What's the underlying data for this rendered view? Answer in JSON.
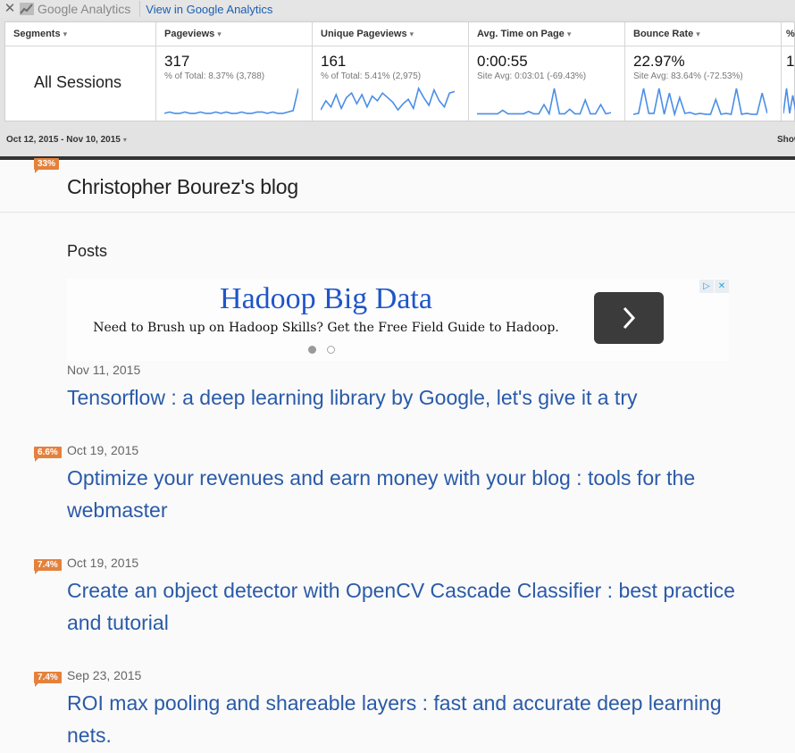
{
  "ga": {
    "close_glyph": "✕",
    "logo_text": "Google Analytics",
    "view_link": "View in Google Analytics",
    "segments_label": "Segments",
    "segment_value": "All Sessions",
    "metrics": [
      {
        "label": "Pageviews",
        "value": "317",
        "sub": "% of Total: 8.37% (3,788)",
        "spark": [
          2,
          3,
          2,
          2,
          3,
          2,
          2,
          3,
          2,
          2,
          3,
          2,
          3,
          2,
          2,
          3,
          2,
          2,
          3,
          3,
          2,
          3,
          2,
          2,
          3,
          4,
          20
        ]
      },
      {
        "label": "Unique Pageviews",
        "value": "161",
        "sub": "% of Total: 5.41% (2,975)",
        "spark": [
          4,
          10,
          6,
          14,
          5,
          12,
          15,
          8,
          14,
          6,
          13,
          10,
          15,
          12,
          9,
          4,
          8,
          11,
          5,
          18,
          12,
          7,
          17,
          10,
          6,
          15,
          16
        ]
      },
      {
        "label": "Avg. Time on Page",
        "value": "0:00:55",
        "sub": "Site Avg: 0:03:01 (-69.43%)",
        "spark": [
          2,
          2,
          2,
          2,
          2,
          5,
          2,
          2,
          2,
          2,
          4,
          2,
          2,
          10,
          2,
          24,
          2,
          2,
          6,
          2,
          2,
          14,
          2,
          2,
          10,
          2,
          3
        ]
      },
      {
        "label": "Bounce Rate",
        "value": "22.97%",
        "sub": "Site Avg: 83.64% (-72.53%)",
        "spark": [
          2,
          3,
          30,
          3,
          3,
          30,
          2,
          25,
          2,
          20,
          3,
          4,
          2,
          3,
          2,
          2,
          18,
          2,
          3,
          2,
          30,
          2,
          3,
          2,
          2,
          25,
          3
        ]
      },
      {
        "label": "%",
        "value": "1",
        "sub": "",
        "spark": [
          2,
          20,
          2,
          15,
          3
        ]
      }
    ],
    "date_range": "Oct 12, 2015 - Nov 10, 2015",
    "show_label": "Show"
  },
  "badges": {
    "title_pct": "33%",
    "post2_pct": "6.6%",
    "post3_pct": "7.4%",
    "post4_pct": "7.4%"
  },
  "blog": {
    "title": "Christopher Bourez's blog",
    "posts_heading": "Posts"
  },
  "ad": {
    "title": "Hadoop Big Data",
    "text": "Need to Brush up on Hadoop Skills? Get the Free Field Guide to Hadoop.",
    "adchoices_left": "▷",
    "adchoices_right": "✕"
  },
  "posts": [
    {
      "date": "Nov 11, 2015",
      "title": "Tensorflow : a deep learning library by Google, let's give it a try"
    },
    {
      "date": "Oct 19, 2015",
      "title": "Optimize your revenues and earn money with your blog : tools for the webmaster"
    },
    {
      "date": "Oct 19, 2015",
      "title": "Create an object detector with OpenCV Cascade Classifier : best practice and tutorial"
    },
    {
      "date": "Sep 23, 2015",
      "title": "ROI max pooling and shareable layers : fast and accurate deep learning nets."
    }
  ],
  "colors": {
    "spark": "#4a8ee8",
    "badge": "#e4813c",
    "link": "#2a5aa8",
    "ad_title": "#1f55c9"
  },
  "icons": [
    "close-icon",
    "google-analytics-logo-icon",
    "caret-down-icon",
    "chevron-right-icon",
    "adchoices-icon"
  ]
}
